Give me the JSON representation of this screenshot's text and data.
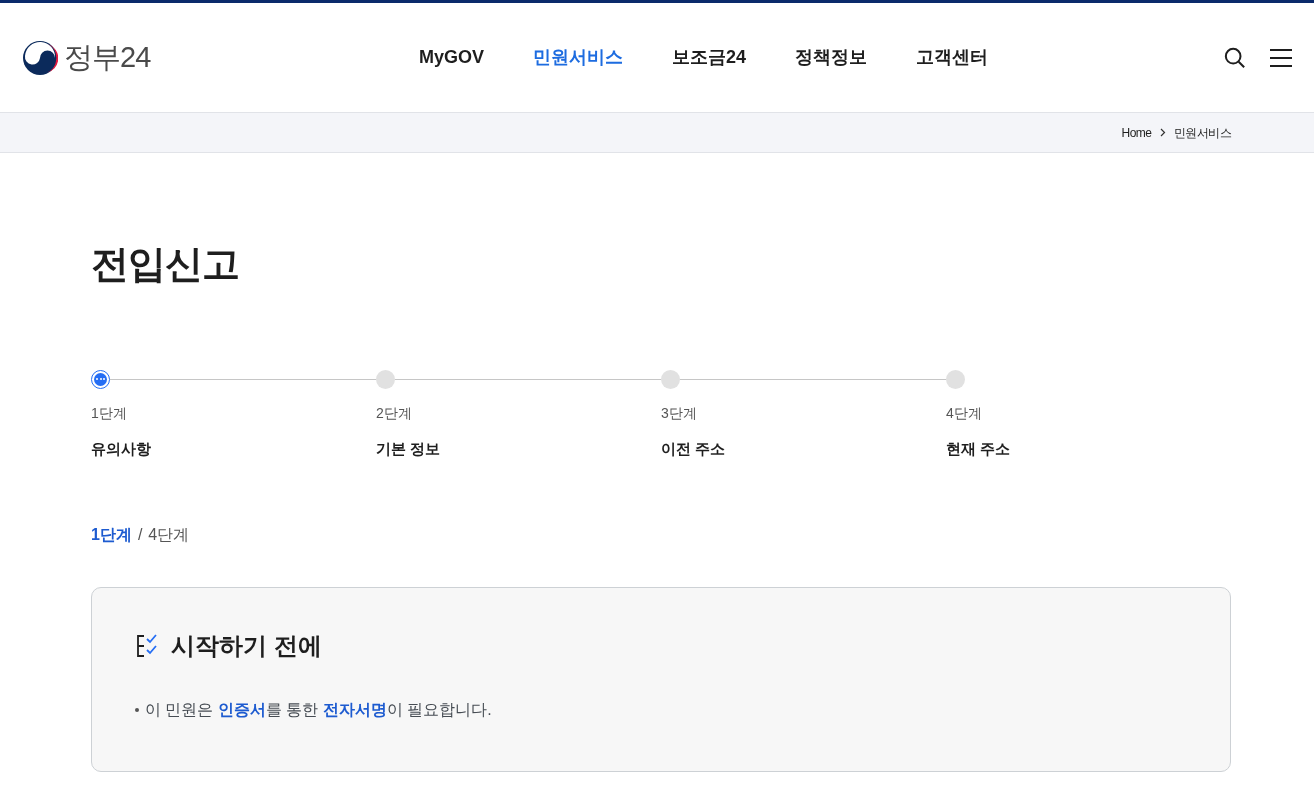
{
  "header": {
    "logo_text": "정부24",
    "nav": [
      {
        "label": "MyGOV",
        "selected": false
      },
      {
        "label": "민원서비스",
        "selected": true
      },
      {
        "label": "보조금24",
        "selected": false
      },
      {
        "label": "정책정보",
        "selected": false
      },
      {
        "label": "고객센터",
        "selected": false
      }
    ]
  },
  "breadcrumb": [
    "Home",
    "민원서비스"
  ],
  "page_title": "전입신고",
  "steps": [
    {
      "number": "1단계",
      "label": "유의사항",
      "selected": true
    },
    {
      "number": "2단계",
      "label": "기본 정보",
      "selected": false
    },
    {
      "number": "3단계",
      "label": "이전 주소",
      "selected": false
    },
    {
      "number": "4단계",
      "label": "현재 주소",
      "selected": false
    }
  ],
  "step_counter": {
    "current": "1단계",
    "separator": "/",
    "total": "4단계"
  },
  "notice": {
    "title": "시작하기 전에",
    "items": [
      [
        {
          "text": "이 민원은 ",
          "emphasis": false
        },
        {
          "text": "인증서",
          "emphasis": true
        },
        {
          "text": "를 통한 ",
          "emphasis": false
        },
        {
          "text": "전자서명",
          "emphasis": true
        },
        {
          "text": "이 필요합니다.",
          "emphasis": false
        }
      ]
    ]
  }
}
